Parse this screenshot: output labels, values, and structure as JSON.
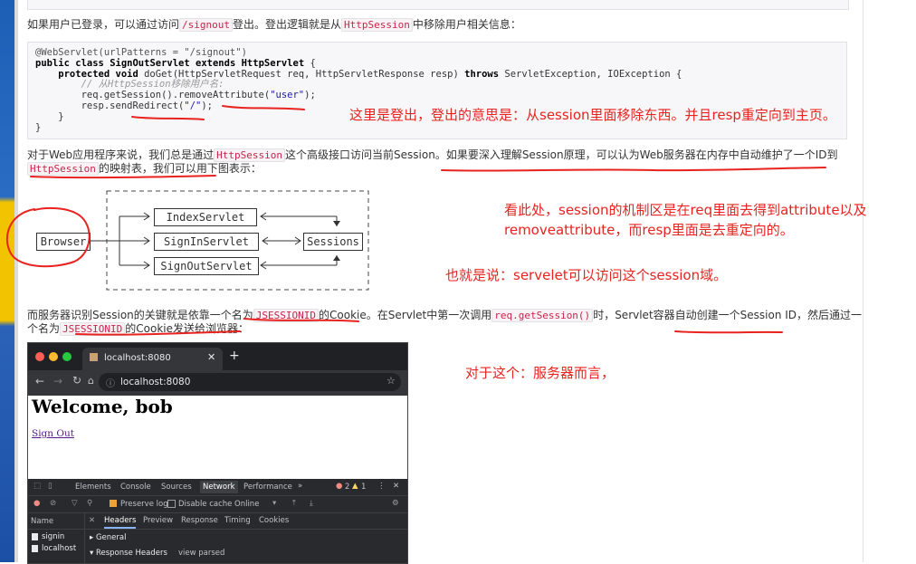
{
  "para1": {
    "t1": "如果用户已登录，可以通过访问",
    "c1": "/signout",
    "t2": "登出。登出逻辑就是从",
    "c2": "HttpSession",
    "t3": "中移除用户相关信息："
  },
  "code": {
    "l1": "@WebServlet(urlPatterns = \"/signout\")",
    "l2a": "public class ",
    "l2b": "SignOutServlet",
    "l2c": " extends ",
    "l2d": "HttpServlet",
    "l2e": " {",
    "l3a": "    protected void ",
    "l3b": "doGet(HttpServletRequest req, HttpServletResponse resp) ",
    "l3c": "throws",
    "l3d": " ServletException, IOException {",
    "l4": "        // 从HttpSession移除用户名:",
    "l5a": "        req.getSession().removeAttribute(",
    "l5b": "\"user\"",
    "l5c": ");",
    "l6a": "        resp.sendRedirect(",
    "l6b": "\"/\"",
    "l6c": ");",
    "l7": "    }",
    "l8": "}"
  },
  "para2": {
    "t1": "对于Web应用程序来说，我们总是通过",
    "c1": "HttpSession",
    "t2": "这个高级接口访问当前Session。如果要深入理解Session原理，可以认为Web服务器在内存中自动维护了一个ID到",
    "c2": "HttpSession",
    "t3": "的映射表，我们可以用下图表示："
  },
  "diagram": {
    "browser": "Browser",
    "index": "IndexServlet",
    "signin": "SignInServlet",
    "signout": "SignOutServlet",
    "sessions": "Sessions"
  },
  "para3": {
    "t1": "而服务器识别Session的关键就是依靠一个名为",
    "c1": "JSESSIONID",
    "t2": "的Cookie。在Servlet中第一次调用",
    "c2": "req.getSession()",
    "t3": "时，Servlet容器自动创建一个Session ID，然后通过一",
    "t4": "个名为",
    "c3": "JSESSIONID",
    "t5": "的Cookie发送给浏览器："
  },
  "notes": {
    "n1": "这里是登出，登出的意思是：从session里面移除东西。并且resp重定向到主页。",
    "n2a": "看此处，session的机制区是在req里面去得到attribute以及",
    "n2b": "removeattribute，而resp里面是去重定向的。",
    "n3": "也就是说：servelet可以访问这个session域。",
    "n4": "对于这个：服务器而言，"
  },
  "browser": {
    "tab_title": "localhost:8080",
    "url": "localhost:8080",
    "heading": "Welcome, bob",
    "link": "Sign Out",
    "devtools": {
      "tabs": [
        "Elements",
        "Console",
        "Sources",
        "Network",
        "Performance",
        "»"
      ],
      "active_tab": "Network",
      "errors": "2",
      "warnings": "1",
      "preserve_log": "Preserve log",
      "disable_cache": "Disable cache",
      "throttle": "Online",
      "name_header": "Name",
      "rows": [
        "signin",
        "localhost"
      ],
      "detail_tabs": [
        "Headers",
        "Preview",
        "Response",
        "Timing",
        "Cookies"
      ],
      "general": "General",
      "response_headers": "Response Headers",
      "view_parsed": "view parsed"
    }
  },
  "colors": {
    "annotation": "#e8231f",
    "code_inline": "#c7254e"
  }
}
